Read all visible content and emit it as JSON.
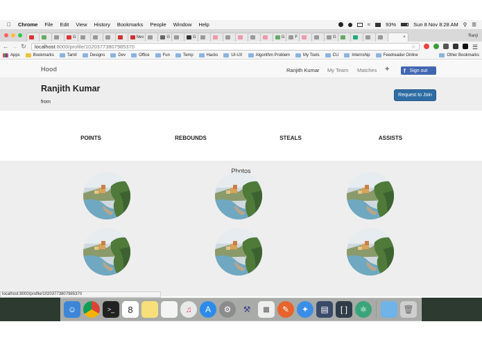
{
  "menubar": {
    "apple": "",
    "items": [
      "Chrome",
      "File",
      "Edit",
      "View",
      "History",
      "Bookmarks",
      "People",
      "Window",
      "Help"
    ],
    "battery": "93%",
    "clock": "Sun 8 Nov  8:28 AM"
  },
  "browser": {
    "profile_name": "Ranji",
    "tabs": [
      "",
      "",
      "",
      "G",
      "",
      "",
      "",
      "",
      "Nev",
      "",
      "G",
      "",
      "G",
      "",
      "",
      "",
      "",
      "",
      "",
      "G",
      "F",
      "",
      "",
      "G",
      "",
      "",
      "",
      ""
    ],
    "active_tab_label": "",
    "url_host": "localhost",
    "url_path": ":8000/profile/10203773807985370",
    "bookmarks": [
      "Apps",
      "Bookmarks",
      "Tamil",
      "Designs",
      "Dev",
      "Office",
      "Fun",
      "Temp",
      "Hacks",
      "UI-UX",
      "Algorithm Problem",
      "My Tools",
      "CU",
      "Internship",
      "Feedreader Online"
    ],
    "other_bookmarks": "Other Bookmarks",
    "status_url": "localhost:8000/profile/10203773807985370"
  },
  "site": {
    "brand": "Hood",
    "nav": [
      "Ranjith Kumar",
      "My Team",
      "Matches"
    ],
    "plus": "+",
    "signout_icon": "f",
    "signout_label": "Sign out",
    "colors": {
      "facebook": "#4267b2",
      "primary": "#2e6da4"
    }
  },
  "profile": {
    "name": "Ranjith Kumar",
    "from_label": "from",
    "join_button": "Request to Join"
  },
  "stats": [
    "POINTS",
    "REBOUNDS",
    "STEALS",
    "ASSISTS"
  ],
  "photos": {
    "title": "Photos",
    "count": 6
  },
  "dock": {
    "calendar_day": "8"
  }
}
